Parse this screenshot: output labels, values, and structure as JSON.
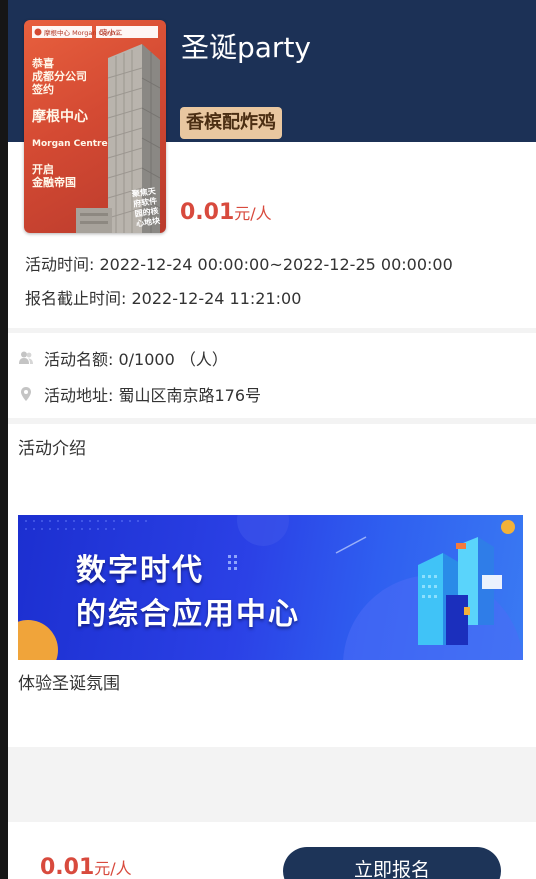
{
  "event": {
    "title": "圣诞party",
    "tag": "香槟配炸鸡",
    "price": {
      "amount": "0.01",
      "unit": "元/人"
    },
    "time_text": "活动时间: 2022-12-24 00:00:00~2022-12-25 00:00:00",
    "deadline_text": "报名截止时间: 2022-12-24 11:21:00"
  },
  "poster": {
    "brand_left": "摩根中心 Morgan Centre",
    "brand_right": "晓小二",
    "lines": "恭喜\n成都分公司\n签约",
    "big_line": "摩根中心",
    "en_line": "Morgan Centre",
    "lines2": "开启\n金融帝国",
    "corner_text": "聚焦天\n府软件\n园的核\n心地块",
    "colors": {
      "background": "#d44a33",
      "text": "#fff7e9"
    }
  },
  "info": {
    "quota_icon": "person-icon",
    "quota_text": "活动名额: 0/1000 （人）",
    "address_icon": "location-pin-icon",
    "address_text": "活动地址: 蜀山区南京路176号"
  },
  "intro": {
    "heading": "活动介绍",
    "banner_text": "数字时代\n的综合应用中心",
    "description": "体验圣诞氛围"
  },
  "footer": {
    "price_amount": "0.01",
    "price_unit": "元/人",
    "signup_label": "立即报名"
  },
  "colors": {
    "header_bg": "#1c3156",
    "accent_price": "#d84a3d",
    "tag_bg": "#e9c7a0",
    "button_bg": "#1d3458"
  }
}
